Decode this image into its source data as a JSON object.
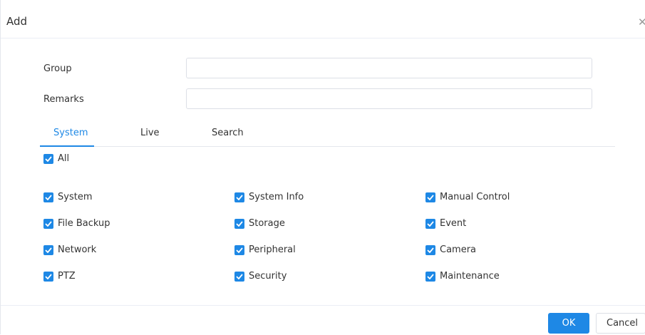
{
  "dialog": {
    "title": "Add",
    "close_icon": "close-icon"
  },
  "form": {
    "group_label": "Group",
    "group_value": "",
    "group_placeholder": "",
    "remarks_label": "Remarks",
    "remarks_value": "",
    "remarks_placeholder": ""
  },
  "tabs": [
    {
      "label": "System",
      "active": true
    },
    {
      "label": "Live",
      "active": false
    },
    {
      "label": "Search",
      "active": false
    }
  ],
  "permissions": {
    "all_label": "All",
    "all_checked": true,
    "items": [
      {
        "label": "System",
        "checked": true
      },
      {
        "label": "System Info",
        "checked": true
      },
      {
        "label": "Manual Control",
        "checked": true
      },
      {
        "label": "File Backup",
        "checked": true
      },
      {
        "label": "Storage",
        "checked": true
      },
      {
        "label": "Event",
        "checked": true
      },
      {
        "label": "Network",
        "checked": true
      },
      {
        "label": "Peripheral",
        "checked": true
      },
      {
        "label": "Camera",
        "checked": true
      },
      {
        "label": "PTZ",
        "checked": true
      },
      {
        "label": "Security",
        "checked": true
      },
      {
        "label": "Maintenance",
        "checked": true
      }
    ]
  },
  "footer": {
    "ok_label": "OK",
    "cancel_label": "Cancel"
  },
  "colors": {
    "accent": "#1e88e5",
    "text": "#333333",
    "border": "#dcdfe6"
  }
}
